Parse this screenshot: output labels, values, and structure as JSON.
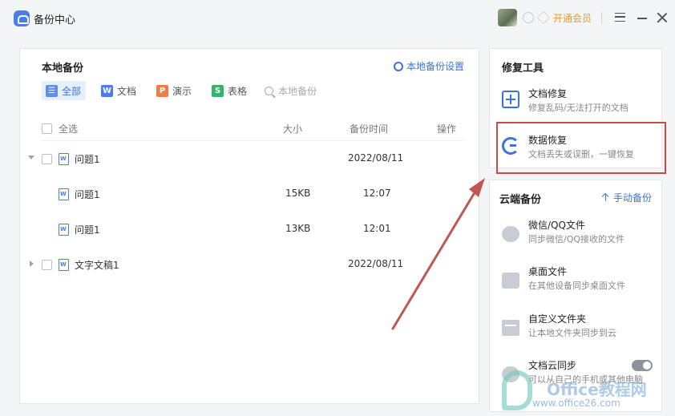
{
  "titlebar": {
    "title": "备份中心",
    "vip_label": "开通会员"
  },
  "local": {
    "title": "本地备份",
    "settings_label": "本地备份设置",
    "filters": {
      "all": "全部",
      "doc": "文档",
      "ppt": "演示",
      "xls": "表格",
      "search_placeholder": "本地备份"
    },
    "columns": {
      "select_all": "全选",
      "size": "大小",
      "time": "备份时间",
      "ops": "操作"
    },
    "rows": [
      {
        "name": "问题1",
        "size": "",
        "time": "2022/08/11",
        "level": 0,
        "expanded": true
      },
      {
        "name": "问题1",
        "size": "15KB",
        "time": "12:07",
        "level": 1
      },
      {
        "name": "问题1",
        "size": "13KB",
        "time": "12:01",
        "level": 1
      },
      {
        "name": "文字文稿1",
        "size": "",
        "time": "2022/08/11",
        "level": 0,
        "expanded": false
      }
    ]
  },
  "repair": {
    "title": "修复工具",
    "items": [
      {
        "title": "文档修复",
        "subtitle": "修复乱码/无法打开的文档",
        "icon": "document-repair-icon"
      },
      {
        "title": "数据恢复",
        "subtitle": "文档丢失或误删，一键恢复",
        "icon": "data-recovery-icon"
      }
    ]
  },
  "cloud": {
    "title": "云端备份",
    "manual_label": "手动备份",
    "items": [
      {
        "title": "微信/QQ文件",
        "subtitle": "同步微信/QQ接收的文件",
        "icon": "chat-icon"
      },
      {
        "title": "桌面文件",
        "subtitle": "在其他设备同步桌面文件",
        "icon": "desktop-icon"
      },
      {
        "title": "自定义文件夹",
        "subtitle": "让本地文件夹同步到云",
        "icon": "folder-icon"
      },
      {
        "title": "文档云同步",
        "subtitle": "可以从自己的手机或其他电脑",
        "icon": "cloud-sync-icon",
        "toggle": "off"
      }
    ]
  },
  "watermark": {
    "brand": "Office教程网",
    "url": "www.office26.com"
  },
  "colors": {
    "accent": "#3b74d9",
    "vip": "#e89a2c",
    "highlight": "#c94a4a",
    "arrow": "#c05656"
  }
}
